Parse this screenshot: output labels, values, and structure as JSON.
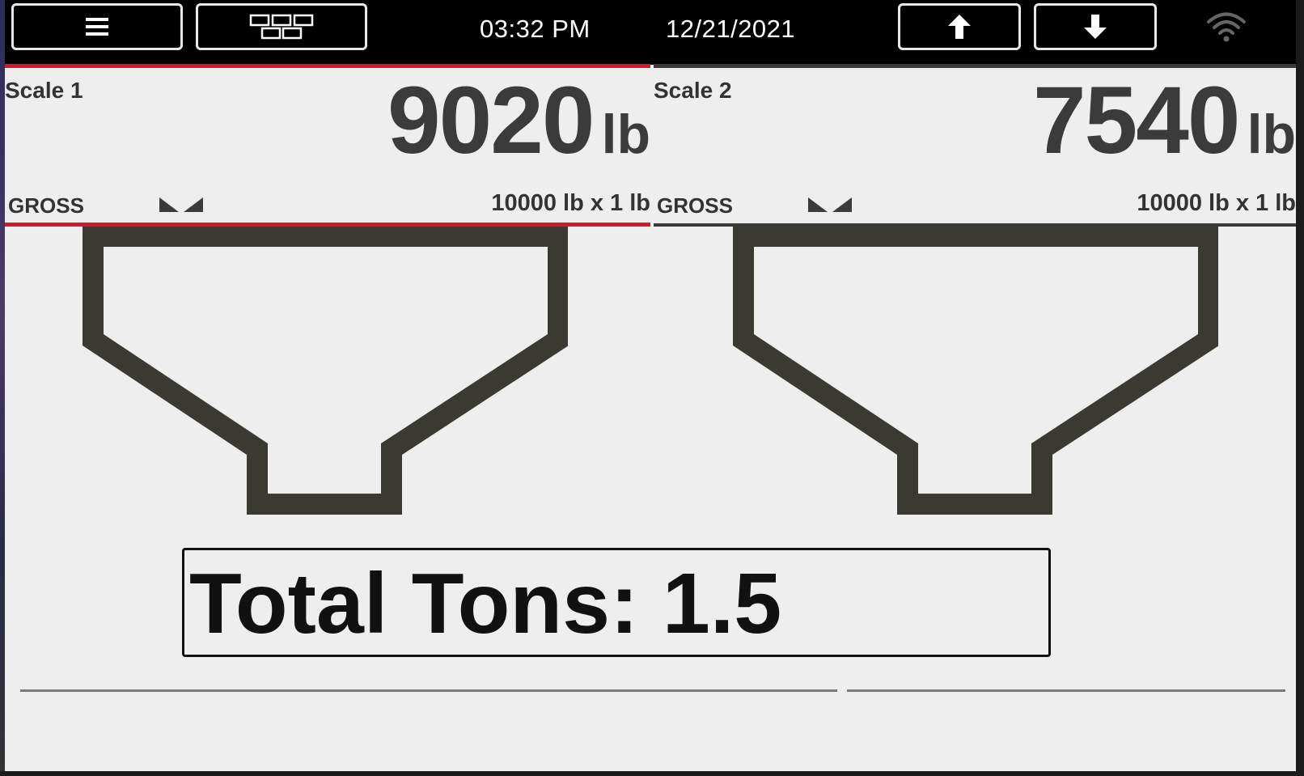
{
  "topbar": {
    "menu_icon": "hamburger-menu-icon",
    "layout_icon": "scale-grid-layout-icon",
    "time": "03:32 PM",
    "date": "12/21/2021",
    "up_icon": "arrow-up-icon",
    "down_icon": "arrow-down-icon",
    "wifi_icon": "wifi-icon"
  },
  "scales": [
    {
      "name": "Scale 1",
      "weight": "9020",
      "unit": "lb",
      "mode": "GROSS",
      "status_icon": "stable-indicator-icon",
      "capacity": "10000 lb x 1 lb",
      "accent_color": "#d4172d"
    },
    {
      "name": "Scale 2",
      "weight": "7540",
      "unit": "lb",
      "mode": "GROSS",
      "status_icon": "stable-indicator-icon",
      "capacity": "10000 lb x 1 lb",
      "accent_color": "#3a3a3a"
    }
  ],
  "hoppers": [
    {
      "icon": "hopper-icon"
    },
    {
      "icon": "hopper-icon"
    }
  ],
  "total": {
    "text": "Total Tons: 1.5"
  },
  "colors": {
    "background": "#efeeee",
    "topbar": "#000000",
    "text_dark": "#3b3b3b",
    "active_scale": "#d4172d"
  }
}
